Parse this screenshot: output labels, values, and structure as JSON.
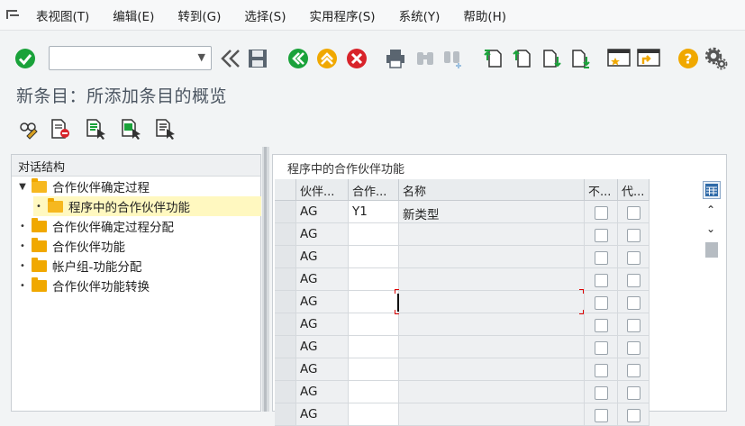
{
  "menubar": {
    "items": [
      "表视图(T)",
      "编辑(E)",
      "转到(G)",
      "选择(S)",
      "实用程序(S)",
      "系统(Y)",
      "帮助(H)"
    ]
  },
  "toolbar": {
    "command_field_value": "",
    "icons": [
      "enter-icon",
      "command-dropdown-icon",
      "collapse-icon",
      "save-icon",
      "back-icon",
      "exit-icon",
      "cancel-icon",
      "print-icon",
      "find-icon",
      "find-next-icon",
      "first-page-icon",
      "previous-page-icon",
      "next-page-icon",
      "last-page-icon",
      "create-session-icon",
      "create-shortcut-icon",
      "help-icon",
      "settings-icon"
    ]
  },
  "page_title": "新条目：所添加条目的概览",
  "tree": {
    "header": "对话结构",
    "items": [
      {
        "label": "合作伙伴确定过程",
        "expanded": true,
        "level": 0
      },
      {
        "label": "程序中的合作伙伴功能",
        "selected": true,
        "level": 1
      },
      {
        "label": "合作伙伴确定过程分配",
        "level": 0
      },
      {
        "label": "合作伙伴功能",
        "level": 0
      },
      {
        "label": "帐户组-功能分配",
        "level": 0
      },
      {
        "label": "合作伙伴功能转换",
        "level": 0
      }
    ]
  },
  "table": {
    "title": "程序中的合作伙伴功能",
    "columns": [
      "伙伴...",
      "合作...",
      "名称",
      "不...",
      "代..."
    ],
    "rows": [
      [
        "AG",
        "Y1",
        "新类型"
      ],
      [
        "AG",
        "",
        ""
      ],
      [
        "AG",
        "",
        ""
      ],
      [
        "AG",
        "",
        ""
      ],
      [
        "AG",
        "",
        ""
      ],
      [
        "AG",
        "",
        ""
      ],
      [
        "AG",
        "",
        ""
      ],
      [
        "AG",
        "",
        ""
      ],
      [
        "AG",
        "",
        ""
      ],
      [
        "AG",
        "",
        ""
      ]
    ]
  },
  "colors": {
    "green": "#1aa23a",
    "orange": "#f0a800",
    "red": "#d8232a",
    "selection": "#fff8c0"
  }
}
